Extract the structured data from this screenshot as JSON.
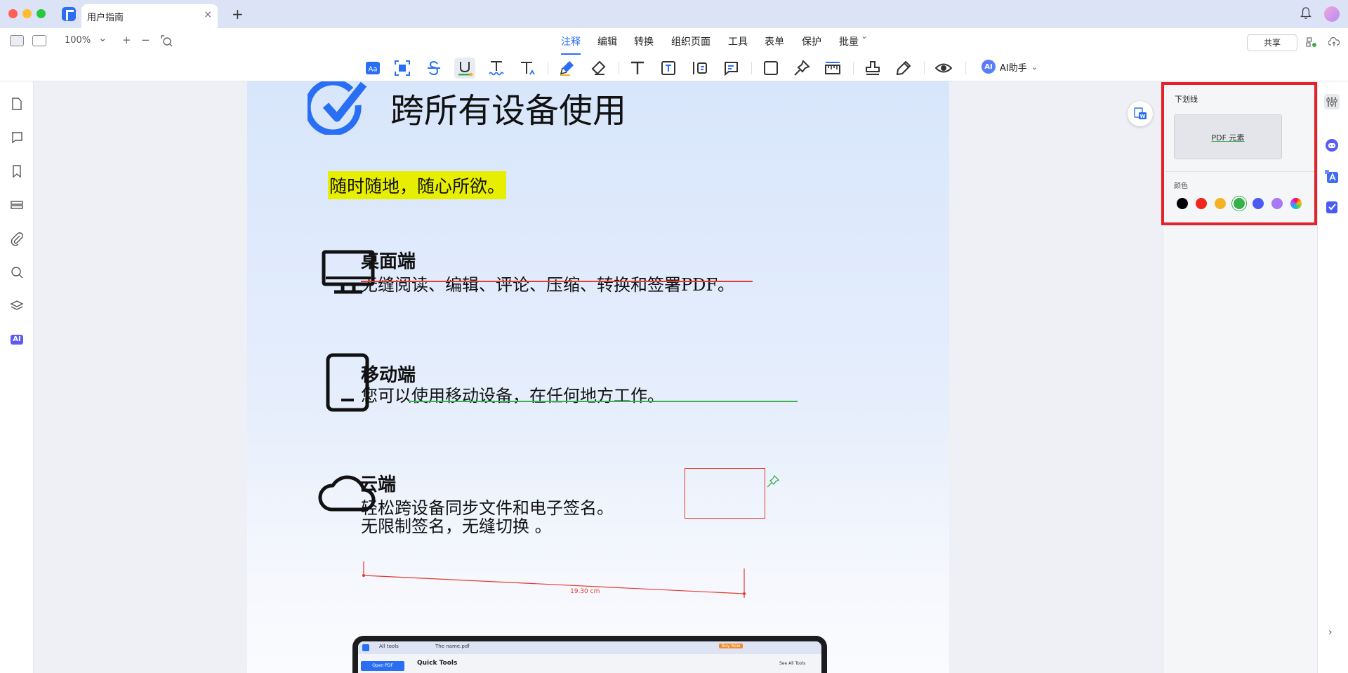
{
  "app": {
    "tab_title": "用户指南",
    "tab_close": "×",
    "new_tab": "+"
  },
  "toolbar": {
    "zoom": "100%",
    "zoom_chevron": "⌄",
    "zoom_in": "+",
    "zoom_out": "−",
    "menus": [
      "注释",
      "编辑",
      "转换",
      "组织页面",
      "工具",
      "表单",
      "保护",
      "批量"
    ],
    "active_menu": "注释",
    "batch_chevron": "⌄",
    "share": "共享",
    "ai_badge": "AI",
    "ai_label": "AI助手",
    "ai_chevron": "⌄"
  },
  "annotation_tools": [
    "text-box-icon",
    "area-highlight-icon",
    "strikethrough-icon",
    "underline-icon",
    "squiggly-icon",
    "insert-text-icon",
    "highlighter-icon",
    "eraser-icon",
    "text-tool-icon",
    "textbox-icon",
    "callout-icon",
    "note-icon",
    "rectangle-icon",
    "pin-icon",
    "measure-icon",
    "stamp-icon",
    "signature-icon",
    "eye-icon"
  ],
  "left_rail": [
    "page-thumbnail-icon",
    "comment-icon",
    "bookmark-icon",
    "fields-icon",
    "attachment-icon",
    "search-icon",
    "layers-icon",
    "ai-icon"
  ],
  "ai_rail_label": "AI",
  "document": {
    "heading": "跨所有设备使用",
    "highlight": "随时随地，随心所欲。",
    "desktop_title": "桌面端",
    "desktop_text": "无缝阅读、编辑、评论、压缩、转换和签署PDF。",
    "mobile_title": "移动端",
    "mobile_text": "您可以使用移动设备，在任何地方工作。",
    "cloud_title": "云端",
    "cloud_text_1": "轻松跨设备同步文件和电子签名。",
    "cloud_text_2": "无限制签名，无缝切换 。",
    "measure": "19.30 cm",
    "laptop_tab_1": "All tools",
    "laptop_tab_2": "The name.pdf",
    "laptop_button": "Buy Now",
    "laptop_sidebar_btn": "Open PDF",
    "laptop_heading": "Quick Tools",
    "laptop_link": "See All Tools"
  },
  "right_panel": {
    "title": "下划线",
    "preview_text": "PDF 元素",
    "color_label": "颜色",
    "colors": [
      "#000000",
      "#f0271b",
      "#f5b324",
      "#36b04a",
      "#4a5cf0",
      "#a879f3",
      "rainbow"
    ],
    "selected_color": "#36b04a"
  },
  "far_rail": [
    "properties-icon",
    "ai-assistant-icon",
    "translate-icon",
    "task-icon"
  ],
  "far_rail_chevron": "›",
  "colors": {
    "accent": "#2a6ff3",
    "highlight": "#e7ee00",
    "strike": "#e43a2f",
    "underline": "#36b04a",
    "frame": "#e5222a"
  }
}
